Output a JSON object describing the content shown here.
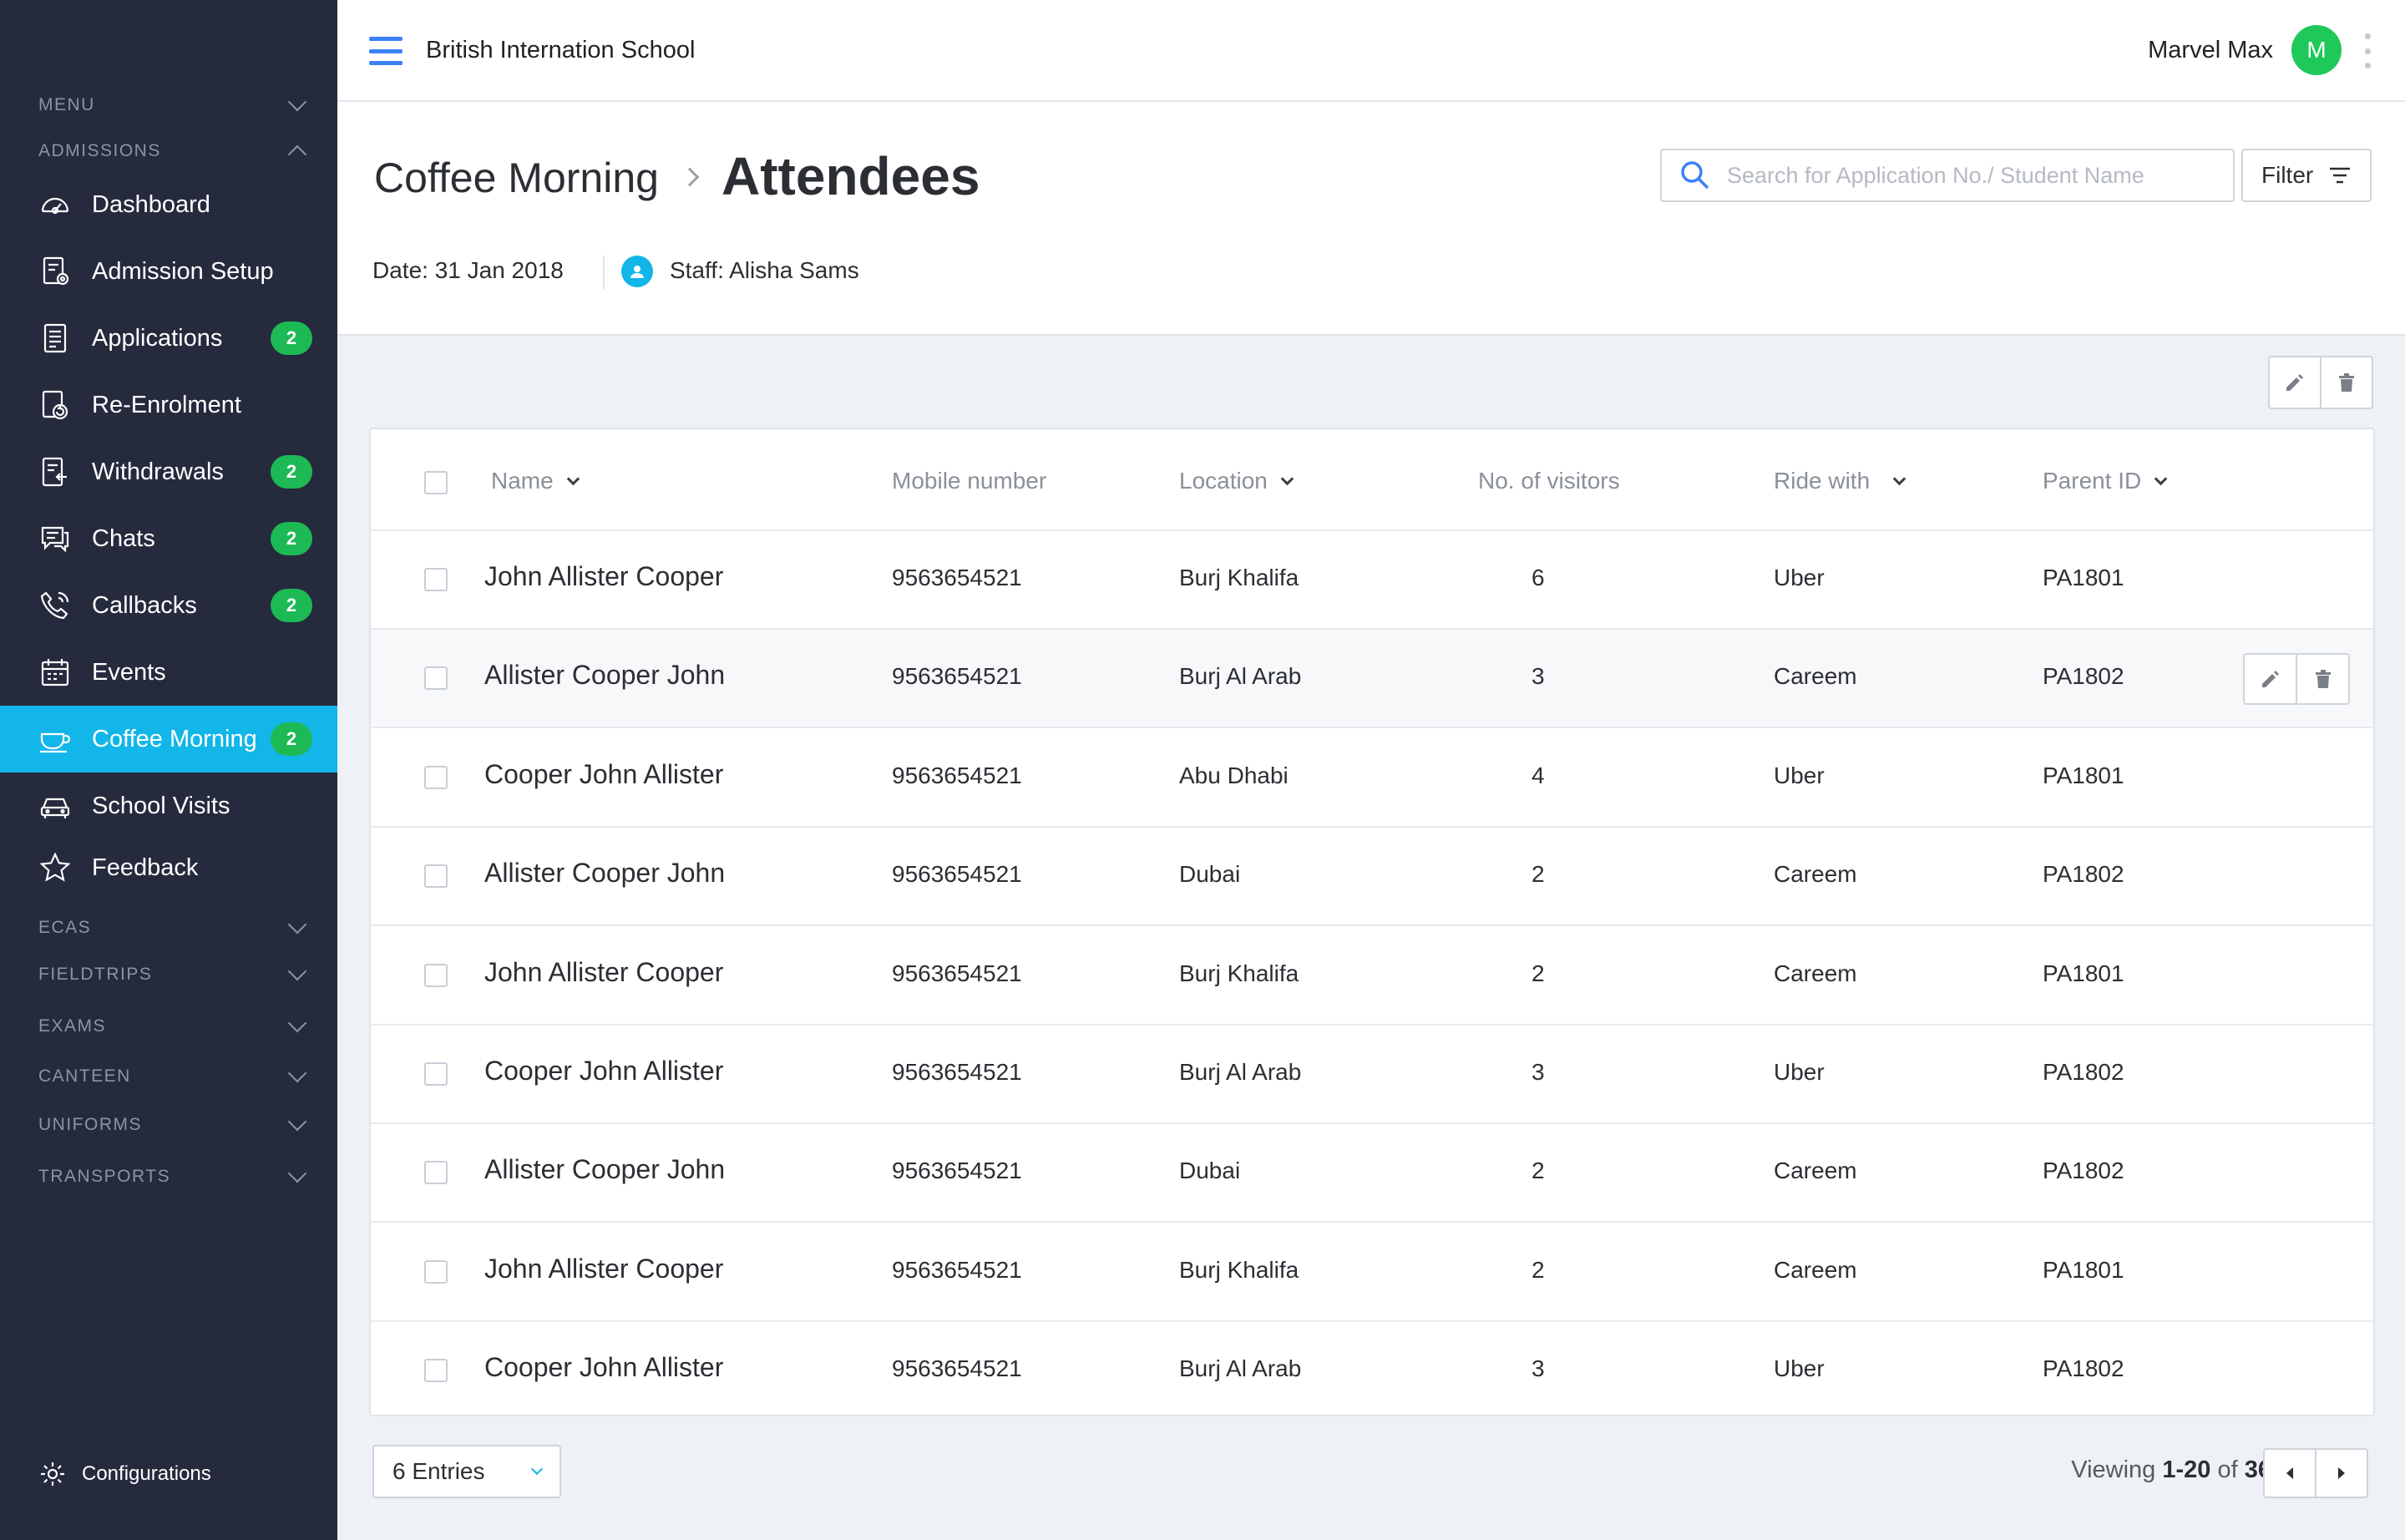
{
  "app": {
    "school_name": "British Internation School",
    "user_name": "Marvel Max",
    "user_initial": "M"
  },
  "sidebar": {
    "sections_top": [
      {
        "label": "MENU",
        "expanded": false
      },
      {
        "label": "ADMISSIONS",
        "expanded": true
      }
    ],
    "items": [
      {
        "label": "Dashboard",
        "icon": "dashboard-icon",
        "badge": null,
        "active": false
      },
      {
        "label": "Admission Setup",
        "icon": "admission-setup-icon",
        "badge": null,
        "active": false
      },
      {
        "label": "Applications",
        "icon": "applications-icon",
        "badge": "2",
        "active": false
      },
      {
        "label": "Re-Enrolment",
        "icon": "re-enrolment-icon",
        "badge": null,
        "active": false
      },
      {
        "label": "Withdrawals",
        "icon": "withdrawals-icon",
        "badge": "2",
        "active": false
      },
      {
        "label": "Chats",
        "icon": "chat-icon",
        "badge": "2",
        "active": false
      },
      {
        "label": "Callbacks",
        "icon": "phone-icon",
        "badge": "2",
        "active": false
      },
      {
        "label": "Events",
        "icon": "calendar-icon",
        "badge": null,
        "active": false
      },
      {
        "label": "Coffee Morning",
        "icon": "coffee-icon",
        "badge": "2",
        "active": true
      },
      {
        "label": "School Visits",
        "icon": "car-icon",
        "badge": null,
        "active": false
      },
      {
        "label": "Feedback",
        "icon": "star-icon",
        "badge": null,
        "active": false
      }
    ],
    "sections_bottom": [
      "ECAS",
      "FIELDTRIPS",
      "EXAMS",
      "CANTEEN",
      "UNIFORMS",
      "TRANSPORTS"
    ],
    "configurations_label": "Configurations"
  },
  "header": {
    "breadcrumb_parent": "Coffee Morning",
    "title": "Attendees",
    "date": "Date: 31 Jan 2018",
    "staff": "Staff: Alisha Sams",
    "search_placeholder": "Search for Application No./ Student Name",
    "filter_label": "Filter"
  },
  "table": {
    "columns": [
      "Name",
      "Mobile number",
      "Location",
      "No. of visitors",
      "Ride with",
      "Parent ID"
    ],
    "rows": [
      [
        "John Allister Cooper",
        "9563654521",
        "Burj Khalifa",
        "6",
        "Uber",
        "PA1801"
      ],
      [
        "Allister Cooper John",
        "9563654521",
        "Burj Al Arab",
        "3",
        "Careem",
        "PA1802"
      ],
      [
        "Cooper John Allister",
        "9563654521",
        "Abu Dhabi",
        "4",
        "Uber",
        "PA1801"
      ],
      [
        "Allister Cooper John",
        "9563654521",
        "Dubai",
        "2",
        "Careem",
        "PA1802"
      ],
      [
        "John Allister Cooper",
        "9563654521",
        "Burj Khalifa",
        "2",
        "Careem",
        "PA1801"
      ],
      [
        "Cooper John Allister",
        "9563654521",
        "Burj Al Arab",
        "3",
        "Uber",
        "PA1802"
      ],
      [
        "Allister Cooper John",
        "9563654521",
        "Dubai",
        "2",
        "Careem",
        "PA1802"
      ],
      [
        "John Allister Cooper",
        "9563654521",
        "Burj Khalifa",
        "2",
        "Careem",
        "PA1801"
      ],
      [
        "Cooper John Allister",
        "9563654521",
        "Burj Al Arab",
        "3",
        "Uber",
        "PA1802"
      ]
    ]
  },
  "footer": {
    "entries_label": "6 Entries",
    "viewing_prefix": "Viewing",
    "viewing_range": "1-20",
    "viewing_of": "of",
    "viewing_total": "36"
  },
  "colors": {
    "sidebar_bg": "#252a3d",
    "accent": "#12b6e8",
    "badge": "#1db954",
    "avatar": "#1ec95a",
    "primary": "#3b82f6"
  }
}
